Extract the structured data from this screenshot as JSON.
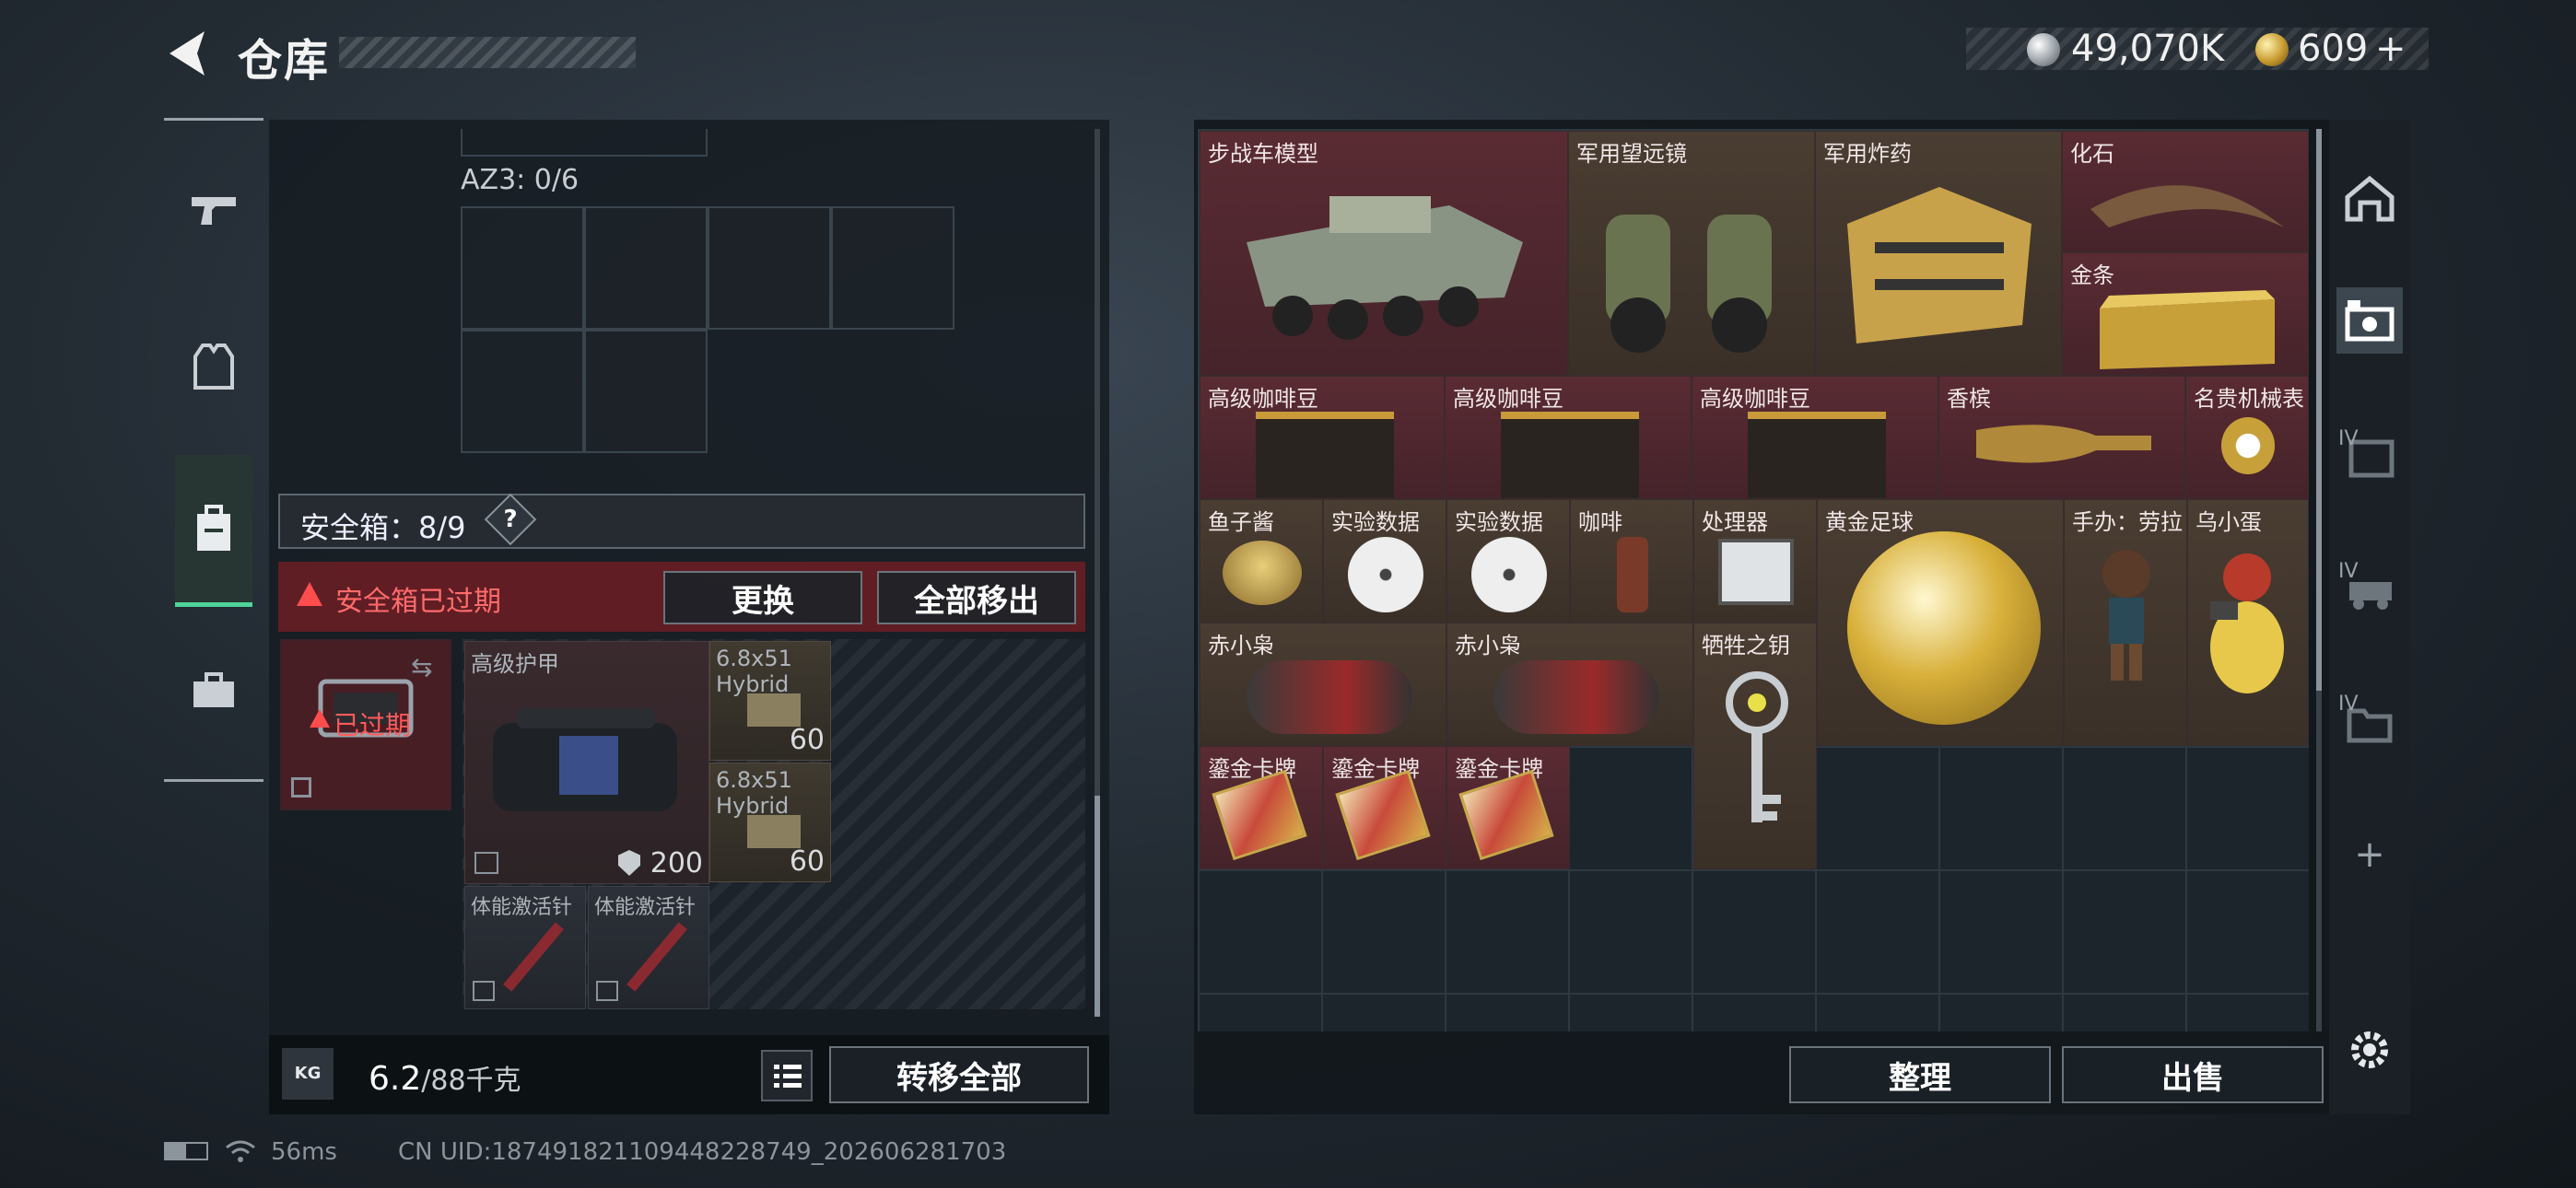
{
  "header": {
    "title": "仓库",
    "silver": "49,070K",
    "gold": "609",
    "gold_plus": "+"
  },
  "left": {
    "az_label": "AZ3: 0/6",
    "safe_box_label": "安全箱：8/9",
    "help": "?",
    "expired_notice": "安全箱已过期",
    "replace_button": "更换",
    "remove_all_button": "全部移出",
    "safe_item_status": "已过期",
    "items": [
      {
        "name": "高级护甲",
        "count": "200"
      },
      {
        "name": "6.8x51 Hybrid",
        "count": "60"
      },
      {
        "name": "6.8x51 Hybrid",
        "count": "60"
      },
      {
        "name": "体能激活针"
      },
      {
        "name": "体能激活针"
      }
    ],
    "weight_value": "6.2",
    "weight_total": "/88千克",
    "transfer_all_button": "转移全部"
  },
  "stash_items": [
    {
      "name": "步战车模型"
    },
    {
      "name": "军用望远镜"
    },
    {
      "name": "军用炸药"
    },
    {
      "name": "化石"
    },
    {
      "name": "金条"
    },
    {
      "name": "高级咖啡豆"
    },
    {
      "name": "高级咖啡豆"
    },
    {
      "name": "高级咖啡豆"
    },
    {
      "name": "香槟"
    },
    {
      "name": "名贵机械表"
    },
    {
      "name": "鱼子酱"
    },
    {
      "name": "实验数据"
    },
    {
      "name": "实验数据"
    },
    {
      "name": "咖啡"
    },
    {
      "name": "处理器"
    },
    {
      "name": "黄金足球"
    },
    {
      "name": "手办：劳拉"
    },
    {
      "name": "乌小蛋"
    },
    {
      "name": "赤小枭"
    },
    {
      "name": "赤小枭"
    },
    {
      "name": "牺牲之钥"
    },
    {
      "name": "鎏金卡牌"
    },
    {
      "name": "鎏金卡牌"
    },
    {
      "name": "鎏金卡牌"
    }
  ],
  "right": {
    "sort_button": "整理",
    "sell_button": "出售",
    "tab_labels": [
      "IV",
      "IV",
      "IV"
    ],
    "add": "+"
  },
  "status": {
    "ping": "56ms",
    "uid": "CN UID:18749182110944822874​9_202606281703"
  }
}
